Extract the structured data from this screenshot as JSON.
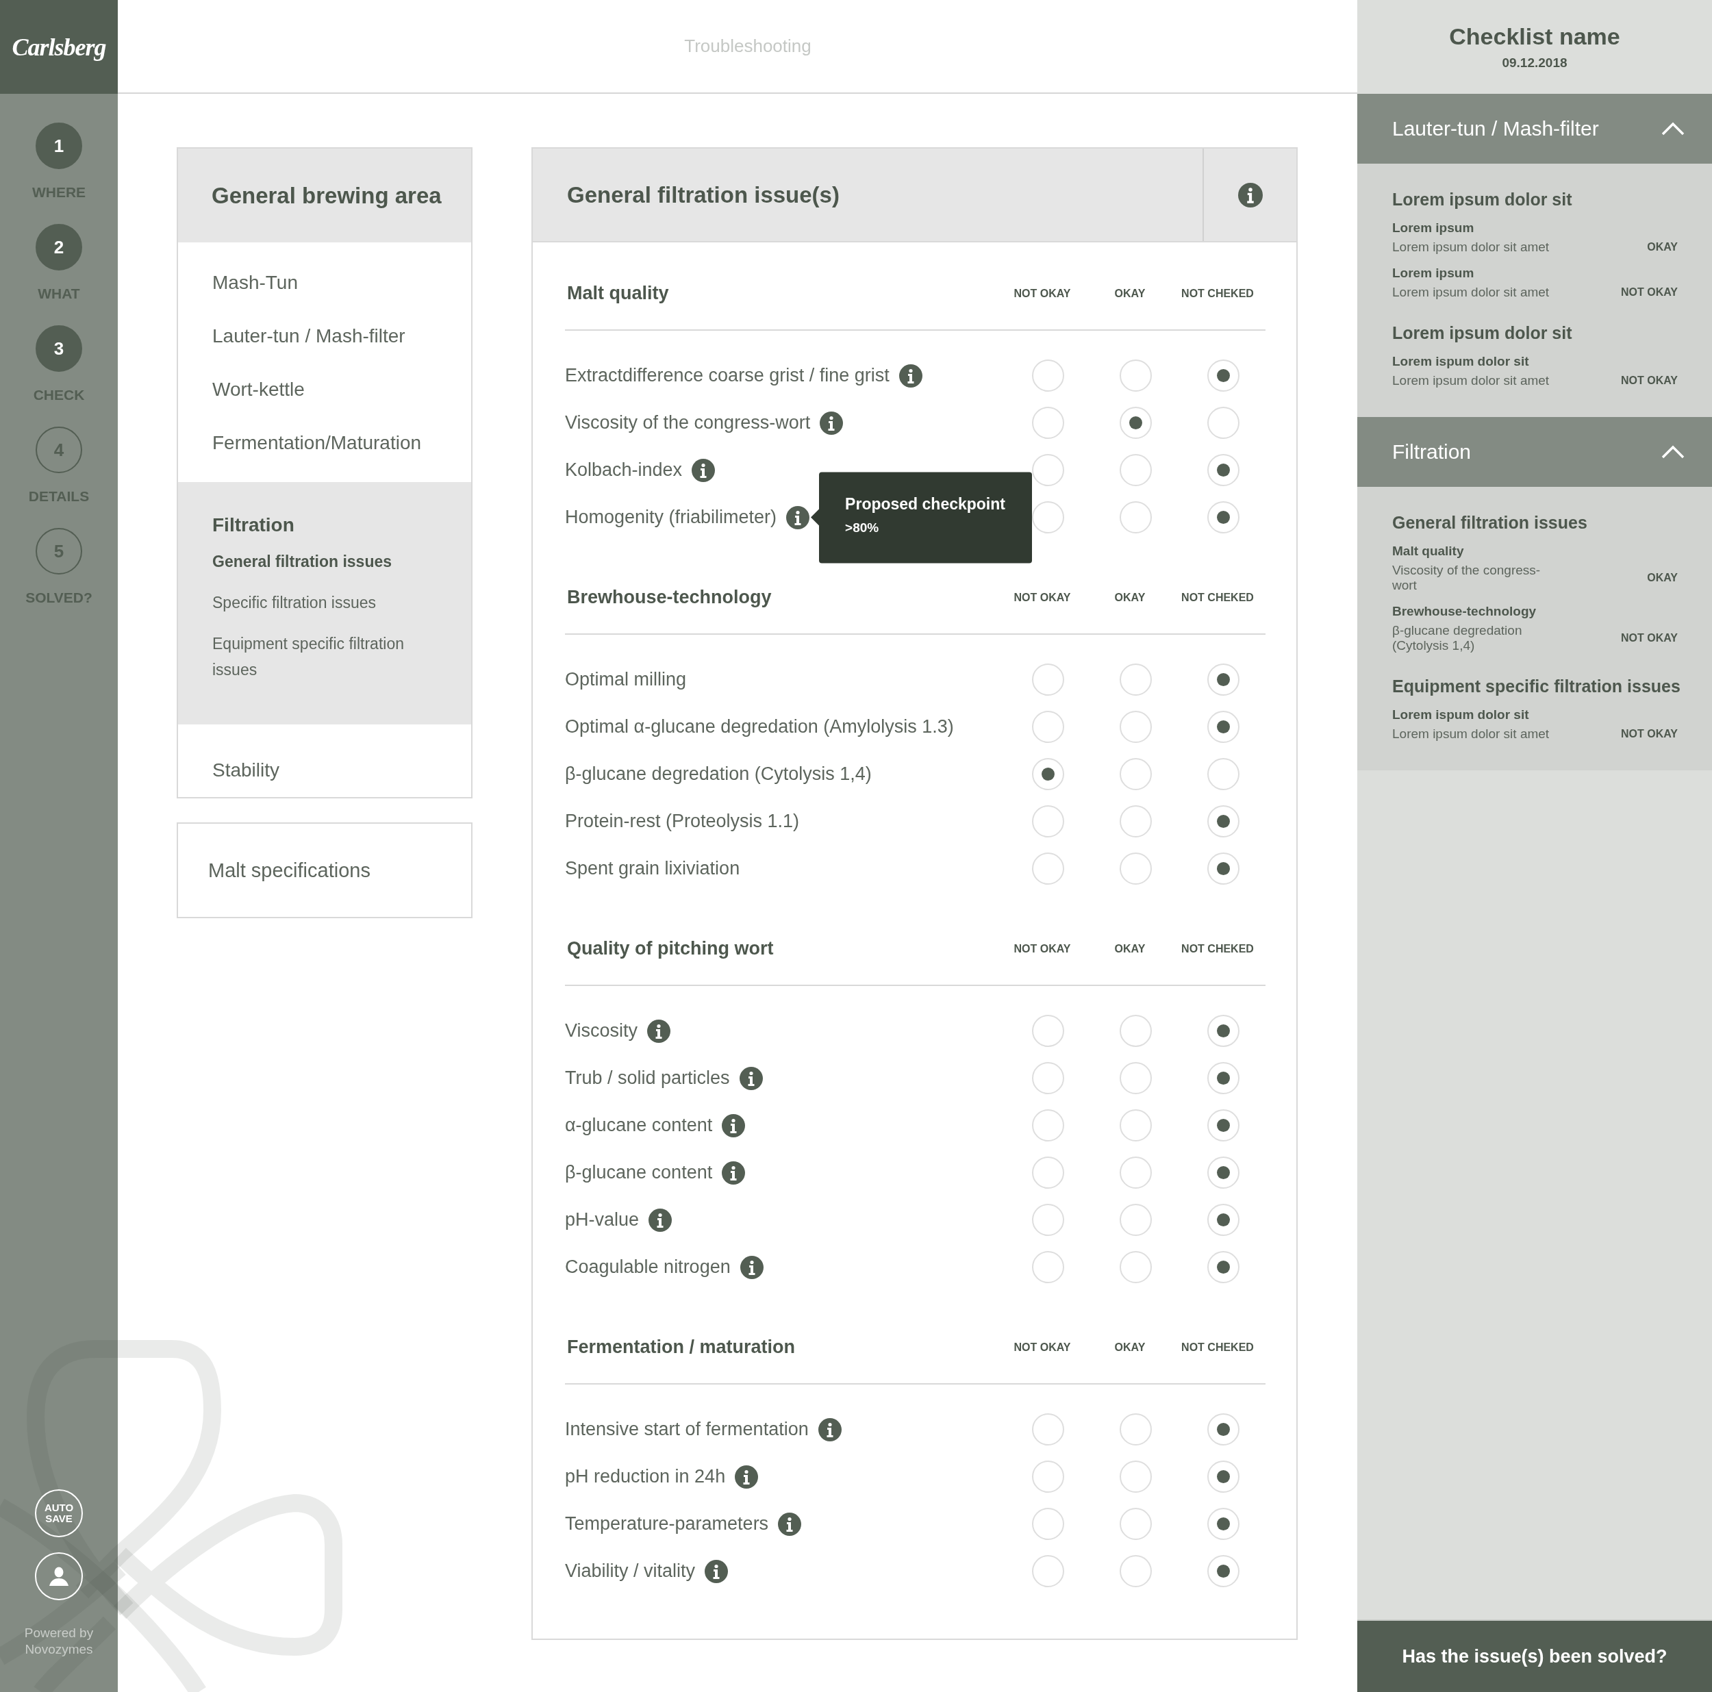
{
  "logo": "Carlsberg",
  "steps": [
    {
      "number": "1",
      "label": "WHERE",
      "completed": true
    },
    {
      "number": "2",
      "label": "WHAT",
      "completed": true
    },
    {
      "number": "3",
      "label": "CHECK",
      "completed": true
    },
    {
      "number": "4",
      "label": "DETAILS",
      "completed": false
    },
    {
      "number": "5",
      "label": "SOLVED?",
      "completed": false
    }
  ],
  "autosave": "AUTO SAVE",
  "powered_by": "Powered by Novozymes",
  "header": {
    "title": "Troubleshooting"
  },
  "area_menu": {
    "title": "General brewing area",
    "items": [
      {
        "label": "Mash-Tun",
        "expanded": false
      },
      {
        "label": "Lauter-tun / Mash-filter",
        "expanded": false
      },
      {
        "label": "Wort-kettle",
        "expanded": false
      },
      {
        "label": "Fermentation/Maturation",
        "expanded": false
      },
      {
        "label": "Filtration",
        "expanded": true,
        "children": [
          {
            "label": "General filtration issues",
            "selected": true
          },
          {
            "label": "Specific filtration issues",
            "selected": false
          },
          {
            "label": "Equipment specific filtration issues",
            "selected": false
          }
        ]
      },
      {
        "label": "Stability",
        "expanded": false
      }
    ]
  },
  "malt_specifications": "Malt specifications",
  "checklist": {
    "title": "General filtration issue(s)",
    "sections": [
      {
        "heading": "Malt quality",
        "columns": [
          "NOT OKAY",
          "OKAY",
          "NOT CHEKED"
        ],
        "rows": [
          {
            "label": "Extractdifference coarse grist / fine grist",
            "info": true,
            "options": [
              {
                "selected": false
              },
              {
                "selected": false
              },
              {
                "selected": true
              }
            ]
          },
          {
            "label": "Viscosity of the congress-wort",
            "info": true,
            "options": [
              {
                "selected": false
              },
              {
                "selected": true
              },
              {
                "selected": false
              }
            ]
          },
          {
            "label": "Kolbach-index",
            "info": true,
            "options": [
              {
                "selected": false
              },
              {
                "selected": false
              },
              {
                "selected": true
              }
            ]
          },
          {
            "label": "Homogenity (friabilimeter)",
            "info": true,
            "tooltip": {
              "title": "Proposed checkpoint",
              "text": ">80%"
            },
            "options": [
              {
                "selected": false
              },
              {
                "selected": false
              },
              {
                "selected": true
              }
            ]
          }
        ]
      },
      {
        "heading": "Brewhouse-technology",
        "columns": [
          "NOT OKAY",
          "OKAY",
          "NOT CHEKED"
        ],
        "rows": [
          {
            "label": "Optimal milling",
            "info": false,
            "options": [
              {
                "selected": false
              },
              {
                "selected": false
              },
              {
                "selected": true
              }
            ]
          },
          {
            "label": "Optimal α-glucane degredation (Amylolysis 1.3)",
            "info": false,
            "options": [
              {
                "selected": false
              },
              {
                "selected": false
              },
              {
                "selected": true
              }
            ]
          },
          {
            "label": "β-glucane degredation (Cytolysis 1,4)",
            "info": false,
            "options": [
              {
                "selected": true
              },
              {
                "selected": false
              },
              {
                "selected": false
              }
            ]
          },
          {
            "label": "Protein-rest (Proteolysis 1.1)",
            "info": false,
            "options": [
              {
                "selected": false
              },
              {
                "selected": false
              },
              {
                "selected": true
              }
            ]
          },
          {
            "label": "Spent grain lixiviation",
            "info": false,
            "options": [
              {
                "selected": false
              },
              {
                "selected": false
              },
              {
                "selected": true
              }
            ]
          }
        ]
      },
      {
        "heading": "Quality of pitching wort",
        "columns": [
          "NOT OKAY",
          "OKAY",
          "NOT CHEKED"
        ],
        "rows": [
          {
            "label": "Viscosity",
            "info": true,
            "options": [
              {
                "selected": false
              },
              {
                "selected": false
              },
              {
                "selected": true
              }
            ]
          },
          {
            "label": "Trub / solid particles",
            "info": true,
            "options": [
              {
                "selected": false
              },
              {
                "selected": false
              },
              {
                "selected": true
              }
            ]
          },
          {
            "label": "α-glucane content",
            "info": true,
            "options": [
              {
                "selected": false
              },
              {
                "selected": false
              },
              {
                "selected": true
              }
            ]
          },
          {
            "label": "β-glucane content",
            "info": true,
            "options": [
              {
                "selected": false
              },
              {
                "selected": false
              },
              {
                "selected": true
              }
            ]
          },
          {
            "label": "pH-value",
            "info": true,
            "options": [
              {
                "selected": false
              },
              {
                "selected": false
              },
              {
                "selected": true
              }
            ]
          },
          {
            "label": "Coagulable nitrogen",
            "info": true,
            "options": [
              {
                "selected": false
              },
              {
                "selected": false
              },
              {
                "selected": true
              }
            ]
          }
        ]
      },
      {
        "heading": "Fermentation / maturation",
        "columns": [
          "NOT OKAY",
          "OKAY",
          "NOT CHEKED"
        ],
        "rows": [
          {
            "label": "Intensive start of fermentation",
            "info": true,
            "options": [
              {
                "selected": false
              },
              {
                "selected": false
              },
              {
                "selected": true
              }
            ]
          },
          {
            "label": "pH reduction in 24h",
            "info": true,
            "options": [
              {
                "selected": false
              },
              {
                "selected": false
              },
              {
                "selected": true
              }
            ]
          },
          {
            "label": "Temperature-parameters",
            "info": true,
            "options": [
              {
                "selected": false
              },
              {
                "selected": false
              },
              {
                "selected": true
              }
            ]
          },
          {
            "label": "Viability / vitality",
            "info": true,
            "options": [
              {
                "selected": false
              },
              {
                "selected": false
              },
              {
                "selected": true
              }
            ]
          }
        ]
      }
    ]
  },
  "summary": {
    "title": "Checklist name",
    "date": "09.12.2018",
    "groups": [
      {
        "title": "Lauter-tun / Mash-filter",
        "expanded": true,
        "sections": [
          {
            "title": "Lorem ipsum dolor sit",
            "entries": [
              {
                "category": "Lorem ipsum",
                "text": "Lorem ipsum dolor sit amet",
                "status": "OKAY"
              },
              {
                "category": "Lorem ipsum",
                "text": "Lorem ipsum dolor sit amet",
                "status": "NOT OKAY"
              }
            ]
          },
          {
            "title": "Lorem ipsum dolor sit",
            "entries": [
              {
                "category": "Lorem ispum dolor sit",
                "text": "Lorem ipsum dolor sit amet",
                "status": "NOT OKAY"
              }
            ]
          }
        ]
      },
      {
        "title": "Filtration",
        "expanded": true,
        "sections": [
          {
            "title": "General filtration issues",
            "entries": [
              {
                "category": "Malt quality",
                "text": "Viscosity of the congress-wort",
                "status": "OKAY"
              },
              {
                "category": "Brewhouse-technology",
                "text": "β-glucane degredation (Cytolysis 1,4)",
                "status": "NOT OKAY"
              }
            ]
          },
          {
            "title": "Equipment specific filtration issues",
            "entries": [
              {
                "category": "Lorem ispum dolor sit",
                "text": "Lorem ipsum dolor sit amet",
                "status": "NOT OKAY"
              }
            ]
          }
        ]
      }
    ]
  },
  "solve_button": "Has the issue(s) been solved?"
}
